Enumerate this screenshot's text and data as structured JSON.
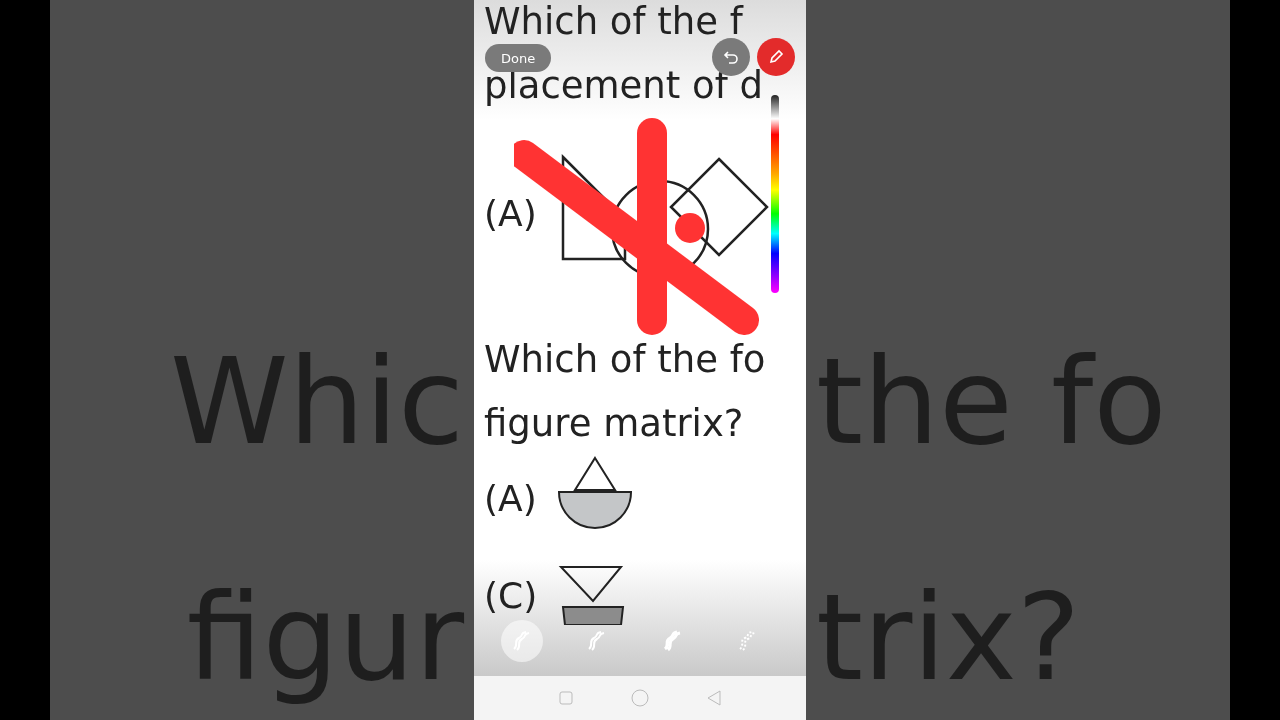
{
  "background_text": {
    "left": [
      "Whic",
      "figur"
    ],
    "right": [
      "the fo",
      "trix?"
    ]
  },
  "top_bar": {
    "done_button": "Done"
  },
  "question_1": {
    "lines": [
      "Which of the f",
      "placement of d"
    ],
    "option_label": "(A)"
  },
  "question_2": {
    "lines": [
      "Which of the fo",
      "figure matrix?"
    ],
    "options": [
      {
        "label": "(A)",
        "kind": "bowl"
      },
      {
        "label": "(C)",
        "kind": "hourglass"
      }
    ]
  },
  "pen_tools": [
    {
      "selected": true
    },
    {
      "selected": false
    },
    {
      "selected": false
    },
    {
      "selected": false
    }
  ]
}
